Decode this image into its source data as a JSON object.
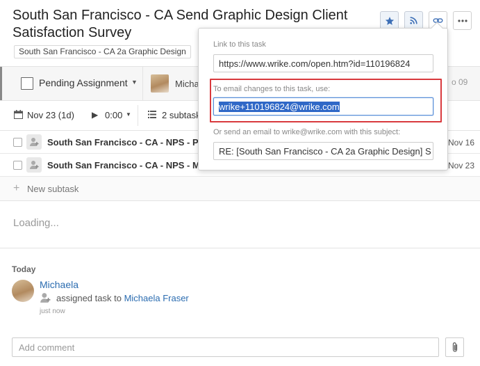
{
  "header": {
    "title": "South San Francisco - CA Send Graphic Design Client Satisfaction Survey",
    "folder_tag": "South San Francisco - CA 2a Graphic Design",
    "buttons": [
      "star-icon",
      "rss-icon",
      "link-icon",
      "more-icon"
    ]
  },
  "status_bar": {
    "status": "Pending Assignment",
    "assignee": "Micha",
    "date_fragment": "o 09"
  },
  "meta": {
    "date": "Nov 23 (1d)",
    "time": "0:00",
    "subtasks": "2 subtask"
  },
  "subtasks": [
    {
      "name": "South San Francisco - CA - NPS - PM",
      "date": "Nov 16"
    },
    {
      "name": "South San Francisco - CA - NPS - Ma",
      "date": "Nov 23"
    }
  ],
  "new_subtask_label": "New subtask",
  "loading_text": "Loading...",
  "activity": {
    "section": "Today",
    "user": "Michaela",
    "action": "assigned task to ",
    "target": "Michaela Fraser",
    "time": "just now"
  },
  "comment": {
    "placeholder": "Add comment"
  },
  "popup": {
    "link_label": "Link to this task",
    "link_value": "https://www.wrike.com/open.htm?id=110196824",
    "email_label": "To email changes to this task, use:",
    "email_value": "wrike+110196824@wrike.com",
    "subject_label": "Or send an email to wrike@wrike.com with this subject:",
    "subject_value": "RE: [South San Francisco - CA 2a Graphic Design] S"
  },
  "colors": {
    "link_blue": "#2b6cb0",
    "selection": "#2f68c7",
    "highlight_red": "#d9393d"
  }
}
